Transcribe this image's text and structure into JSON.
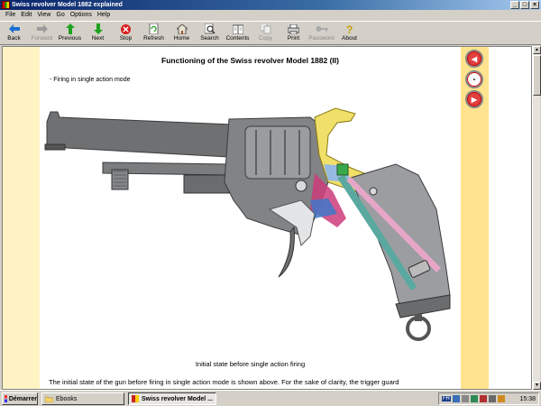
{
  "window": {
    "title": "Swiss revolver Model 1882 explained"
  },
  "menu": [
    "File",
    "Edit",
    "View",
    "Go",
    "Options",
    "Help"
  ],
  "toolbar": {
    "back": "Back",
    "forward": "Forward",
    "previous": "Previous",
    "next": "Next",
    "stop": "Stop",
    "refresh": "Refresh",
    "home": "Home",
    "search": "Search",
    "contents": "Contents",
    "copy": "Copy",
    "print": "Print",
    "password": "Password",
    "about": "About"
  },
  "page": {
    "title": "Functioning of the Swiss revolver Model 1882 (II)",
    "section": "- Firing in single action mode",
    "caption": "Initial state before single action firing",
    "body": "The initial state of the gun before firing in single action mode is shown above. For the sake of clarity, the trigger guard"
  },
  "taskbar": {
    "start": "Démarrer",
    "tasks": [
      "Ebooks",
      "Swiss revolver Model ..."
    ],
    "lang": "FR",
    "clock": "15:38"
  }
}
